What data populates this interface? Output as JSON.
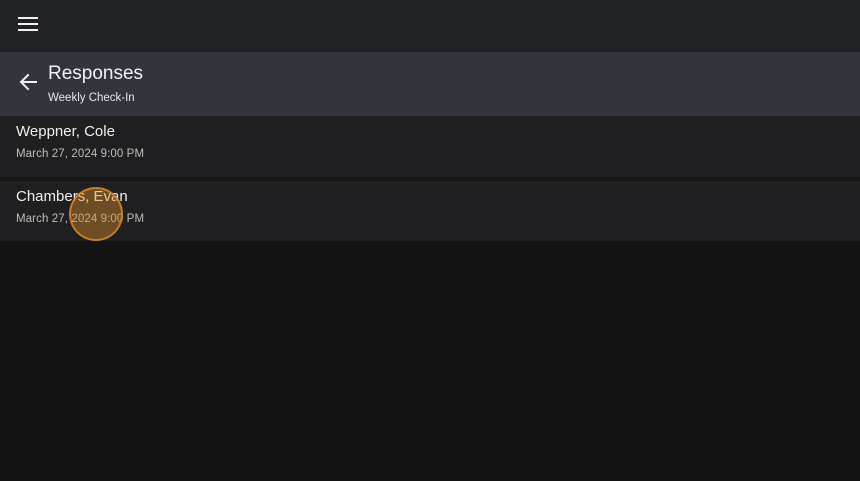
{
  "app_bar": {
    "menu_icon": "hamburger-menu-icon"
  },
  "header": {
    "back_icon": "arrow-left-icon",
    "title": "Responses",
    "subtitle": "Weekly Check-In"
  },
  "responses": [
    {
      "name": "Weppner, Cole",
      "date": "March 27, 2024 9:00 PM"
    },
    {
      "name": "Chambers, Evan",
      "date": "March 27, 2024 9:00 PM"
    }
  ],
  "colors": {
    "background": "#131313",
    "app_bar": "#212226",
    "header": "#32363c",
    "row": "#1f1f21",
    "touch_indicator": "#de8c28"
  }
}
